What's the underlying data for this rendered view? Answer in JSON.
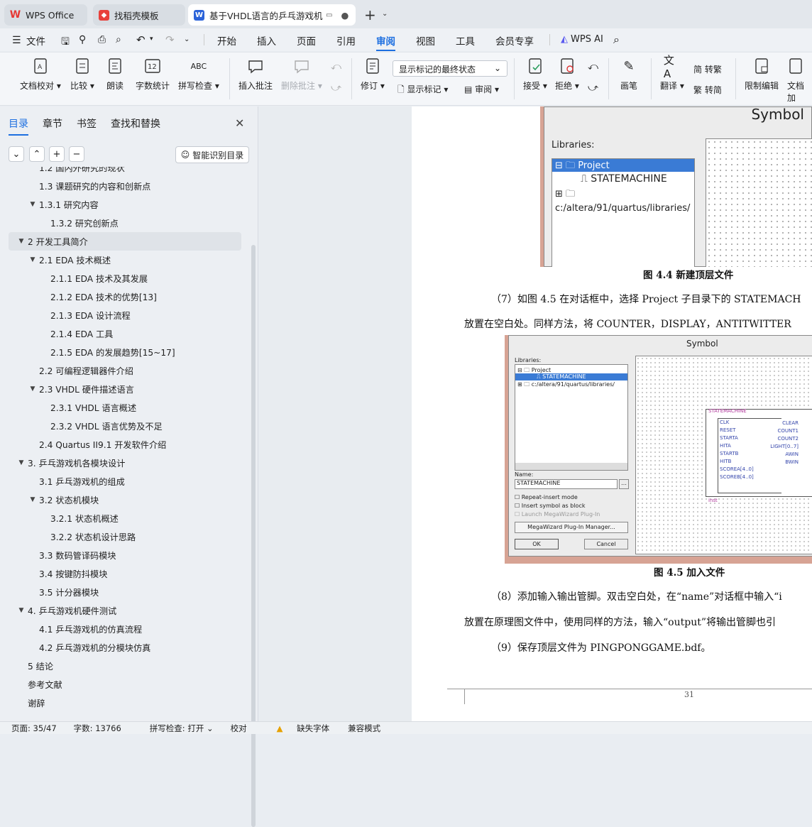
{
  "tabs": [
    {
      "label": "WPS Office",
      "icon": "wps-logo-icon"
    },
    {
      "label": "找稻壳模板",
      "icon": "docer-icon"
    },
    {
      "label": "基于VHDL语言的乒乓游戏机的",
      "icon": "word-doc-icon"
    }
  ],
  "menu": {
    "file": "文件",
    "items": [
      "开始",
      "插入",
      "页面",
      "引用",
      "审阅",
      "视图",
      "工具",
      "会员专享"
    ],
    "active": "审阅",
    "ai": "WPS AI"
  },
  "ribbon": {
    "doc_check": "文档校对",
    "compare": "比较",
    "read_aloud": "朗读",
    "word_count": "字数统计",
    "spell_check": "拼写检查",
    "insert_comment": "插入批注",
    "delete_comment": "删除批注",
    "revise": "修订",
    "markup_select": "显示标记的最终状态",
    "show_markup": "显示标记",
    "review": "审阅",
    "accept": "接受",
    "reject": "拒绝",
    "pen": "画笔",
    "translate": "翻译",
    "to_traditional": "简 转繁",
    "to_simplified": "繁 转简",
    "restrict_edit": "限制编辑",
    "doc_encrypt": "文档加"
  },
  "sidebar": {
    "tabs": [
      "目录",
      "章节",
      "书签",
      "查找和替换"
    ],
    "ai_toc": "智能识别目录",
    "toc": [
      {
        "label": "1.2 国内外研究的现状",
        "level": 2,
        "arrow": ""
      },
      {
        "label": "1.3 课题研究的内容和创新点",
        "level": 2,
        "arrow": ""
      },
      {
        "label": "1.3.1  研究内容",
        "level": 2,
        "arrow": "▼"
      },
      {
        "label": "1.3.2  研究创新点",
        "level": 3,
        "arrow": ""
      },
      {
        "label": "2  开发工具简介",
        "level": 1,
        "arrow": "▼",
        "selected": true
      },
      {
        "label": "2.1 EDA 技术概述",
        "level": 2,
        "arrow": "▼"
      },
      {
        "label": "2.1.1 EDA 技术及其发展",
        "level": 3,
        "arrow": ""
      },
      {
        "label": "2.1.2 EDA 技术的优势[13]",
        "level": 3,
        "arrow": ""
      },
      {
        "label": "2.1.3 EDA 设计流程",
        "level": 3,
        "arrow": ""
      },
      {
        "label": "2.1.4 EDA 工具",
        "level": 3,
        "arrow": ""
      },
      {
        "label": "2.1.5 EDA 的发展趋势[15~17]",
        "level": 3,
        "arrow": ""
      },
      {
        "label": "2.2 可编程逻辑器件介绍",
        "level": 2,
        "arrow": ""
      },
      {
        "label": "2.3 VHDL 硬件描述语言",
        "level": 2,
        "arrow": "▼"
      },
      {
        "label": "2.3.1 VHDL 语言概述",
        "level": 3,
        "arrow": ""
      },
      {
        "label": "2.3.2 VHDL 语言优势及不足",
        "level": 3,
        "arrow": ""
      },
      {
        "label": "2.4 Quartus II9.1 开发软件介绍",
        "level": 2,
        "arrow": ""
      },
      {
        "label": "3.  乒乓游戏机各模块设计",
        "level": 1,
        "arrow": "▼"
      },
      {
        "label": "3.1 乒乓游戏机的组成",
        "level": 2,
        "arrow": ""
      },
      {
        "label": "3.2 状态机模块",
        "level": 2,
        "arrow": "▼"
      },
      {
        "label": "3.2.1  状态机概述",
        "level": 3,
        "arrow": ""
      },
      {
        "label": "3.2.2  状态机设计思路",
        "level": 3,
        "arrow": ""
      },
      {
        "label": "3.3 数码管译码模块",
        "level": 2,
        "arrow": ""
      },
      {
        "label": "3.4 按键防抖模块",
        "level": 2,
        "arrow": ""
      },
      {
        "label": "3.5 计分器模块",
        "level": 2,
        "arrow": ""
      },
      {
        "label": "4.  乒乓游戏机硬件测试",
        "level": 1,
        "arrow": "▼"
      },
      {
        "label": "4.1 乒乓游戏机的仿真流程",
        "level": 2,
        "arrow": ""
      },
      {
        "label": "4.2 乒乓游戏机的分模块仿真",
        "level": 2,
        "arrow": ""
      },
      {
        "label": "5  结论",
        "level": 1,
        "arrow": ""
      },
      {
        "label": "参考文献",
        "level": 1,
        "arrow": ""
      },
      {
        "label": "谢辞",
        "level": 1,
        "arrow": ""
      }
    ]
  },
  "document": {
    "fig44_title": "Symbol",
    "fig44_libraries": "Libraries:",
    "fig44_project": "Project",
    "fig44_statemachine": "STATEMACHINE",
    "fig44_path": "c:/altera/91/quartus/libraries/",
    "fig44_caption": "图 4.4  新建顶层文件",
    "para7_line1": "（7）如图 4.5 在对话框中，选择 Project 子目录下的 STATEMACH",
    "para7_line2": "放置在空白处。同样方法，将 COUNTER，DISPLAY，ANTITWITTER",
    "fig45_title": "Symbol",
    "fig45_libraries": "Libraries:",
    "fig45_project": "Project",
    "fig45_statemachine": "STATEMACHINE",
    "fig45_path": "c:/altera/91/quartus/libraries/",
    "fig45_name_label": "Name:",
    "fig45_name_value": "STATEMACHINE",
    "fig45_opt1": "Repeat-insert mode",
    "fig45_opt2": "Insert symbol as block",
    "fig45_opt3": "Launch MegaWizard Plug-In",
    "fig45_mega": "MegaWizard Plug-In Manager...",
    "fig45_ok": "OK",
    "fig45_cancel": "Cancel",
    "sym_title": "STATEMACHINE",
    "sym_inputs": [
      "CLK",
      "RESET",
      "STARTA",
      "HITA",
      "STARTB",
      "HITB",
      "SCOREA[4..0]",
      "SCOREB[4..0]"
    ],
    "sym_outputs": [
      "CLEAR",
      "COUNT1",
      "COUNT2",
      "LIGHT[0..7]",
      "AWIN",
      "BWIN"
    ],
    "sym_inst": "inst",
    "fig45_caption": "图 4.5  加入文件",
    "para8_line1": "（8）添加输入输出管脚。双击空白处，在“name”对话框中输入“i",
    "para8_line2": "放置在原理图文件中，使用同样的方法，输入“output”将输出管脚也引",
    "para9": "（9）保存顶层文件为 PINGPONGGAME.bdf。",
    "page_number": "31"
  },
  "status": {
    "page": "页面: 35/47",
    "words": "字数: 13766",
    "spell": "拼写检查: 打开",
    "proof": "校对",
    "missing_font": "缺失字体",
    "compat": "兼容模式"
  }
}
